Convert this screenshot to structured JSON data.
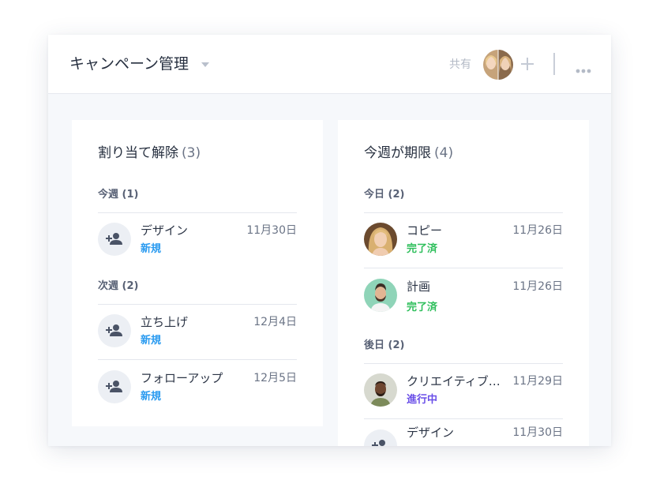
{
  "header": {
    "title": "キャンペーン管理",
    "share_label": "共有",
    "icons": [
      "chevron-down-icon",
      "plus-icon",
      "more-icon"
    ]
  },
  "columns": [
    {
      "title": "割り当て解除",
      "count": "(3)",
      "groups": [
        {
          "label": "今週 (1)",
          "tasks": [
            {
              "name": "デザイン",
              "date": "11月30日",
              "status": "新規"
            }
          ]
        },
        {
          "label": "次週 (2)",
          "tasks": [
            {
              "name": "立ち上げ",
              "date": "12月4日",
              "status": "新規"
            },
            {
              "name": "フォローアップ",
              "date": "12月5日",
              "status": "新規"
            }
          ]
        }
      ]
    },
    {
      "title": "今週が期限",
      "count": "(4)",
      "groups": [
        {
          "label": "今日 (2)",
          "tasks": [
            {
              "name": "コピー",
              "date": "11月26日",
              "status": "完了済"
            },
            {
              "name": "計画",
              "date": "11月26日",
              "status": "完了済"
            }
          ]
        },
        {
          "label": "後日 (2)",
          "tasks": [
            {
              "name": "クリエイティブ…",
              "date": "11月29日",
              "status": "進行中"
            },
            {
              "name": "デザイン",
              "date": "11月30日",
              "status": ""
            }
          ]
        }
      ]
    }
  ],
  "colors": {
    "status_new": "#2b9bf0",
    "status_done": "#2fbf5c",
    "status_in_progress": "#6a4fe8"
  }
}
